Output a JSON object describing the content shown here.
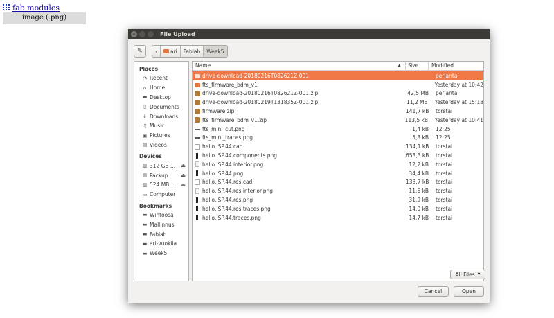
{
  "page": {
    "fab_link_text": "fab modules",
    "image_button_label": "image (.png)"
  },
  "dialog": {
    "title": "File Upload",
    "path": [
      {
        "label": "ari",
        "icon": "home-folder-icon"
      },
      {
        "label": "Fablab"
      },
      {
        "label": "Week5",
        "active": true
      }
    ],
    "places_heading": "Places",
    "places": [
      {
        "label": "Recent",
        "icon": "clock-icon"
      },
      {
        "label": "Home",
        "icon": "home-icon"
      },
      {
        "label": "Desktop",
        "icon": "desktop-folder-icon"
      },
      {
        "label": "Documents",
        "icon": "document-icon"
      },
      {
        "label": "Downloads",
        "icon": "download-icon"
      },
      {
        "label": "Music",
        "icon": "music-icon"
      },
      {
        "label": "Pictures",
        "icon": "camera-icon"
      },
      {
        "label": "Videos",
        "icon": "film-icon"
      }
    ],
    "devices_heading": "Devices",
    "devices": [
      {
        "label": "312 GB ...",
        "icon": "drive-icon",
        "eject": true
      },
      {
        "label": "Packup",
        "icon": "drive-icon",
        "eject": true
      },
      {
        "label": "524 MB ...",
        "icon": "drive-icon",
        "eject": true
      },
      {
        "label": "Computer",
        "icon": "computer-icon"
      }
    ],
    "bookmarks_heading": "Bookmarks",
    "bookmarks": [
      {
        "label": "Wintoosa"
      },
      {
        "label": "Mallinnus"
      },
      {
        "label": "Fablab"
      },
      {
        "label": "ari-vuokila"
      },
      {
        "label": "Week5"
      }
    ],
    "columns": {
      "name": "Name",
      "size": "Size",
      "modified": "Modified"
    },
    "files": [
      {
        "name": "drive-download-20180216T082621Z-001",
        "size": "",
        "modified": "perjantai",
        "type": "folder",
        "selected": true
      },
      {
        "name": "fts_firmware_bdm_v1",
        "size": "",
        "modified": "Yesterday at 10:42",
        "type": "folder"
      },
      {
        "name": "drive-download-20180216T082621Z-001.zip",
        "size": "42,5 MB",
        "modified": "perjantai",
        "type": "zip"
      },
      {
        "name": "drive-download-20180219T131835Z-001.zip",
        "size": "11,2 MB",
        "modified": "Yesterday at 15:18",
        "type": "zip"
      },
      {
        "name": "firmware.zip",
        "size": "141,7 kB",
        "modified": "torstai",
        "type": "zip"
      },
      {
        "name": "fts_firmware_bdm_v1.zip",
        "size": "113,5 kB",
        "modified": "Yesterday at 10:41",
        "type": "zip"
      },
      {
        "name": "fts_mini_cut.png",
        "size": "1,4 kB",
        "modified": "12:25",
        "type": "img-strip"
      },
      {
        "name": "fts_mini_traces.png",
        "size": "5,8 kB",
        "modified": "12:25",
        "type": "img-strip"
      },
      {
        "name": "hello.ISP.44.cad",
        "size": "134,1 kB",
        "modified": "torstai",
        "type": "cad"
      },
      {
        "name": "hello.ISP.44.components.png",
        "size": "653,3 kB",
        "modified": "torstai",
        "type": "img-dark"
      },
      {
        "name": "hello.ISP.44.interior.png",
        "size": "12,2 kB",
        "modified": "torstai",
        "type": "img-light"
      },
      {
        "name": "hello.ISP.44.png",
        "size": "34,4 kB",
        "modified": "torstai",
        "type": "img-dark"
      },
      {
        "name": "hello.ISP.44.res.cad",
        "size": "133,7 kB",
        "modified": "torstai",
        "type": "cad"
      },
      {
        "name": "hello.ISP.44.res.interior.png",
        "size": "11,6 kB",
        "modified": "torstai",
        "type": "img-light"
      },
      {
        "name": "hello.ISP.44.res.png",
        "size": "31,9 kB",
        "modified": "torstai",
        "type": "img-dark"
      },
      {
        "name": "hello.ISP.44.res.traces.png",
        "size": "14,0 kB",
        "modified": "torstai",
        "type": "img-dark"
      },
      {
        "name": "hello.ISP.44.traces.png",
        "size": "14,7 kB",
        "modified": "torstai",
        "type": "img-dark"
      }
    ],
    "filter_label": "All Files",
    "cancel_label": "Cancel",
    "open_label": "Open",
    "colors": {
      "selection": "#f07746",
      "folder": "#e0763c",
      "titlebar": "#3c3b37"
    }
  }
}
